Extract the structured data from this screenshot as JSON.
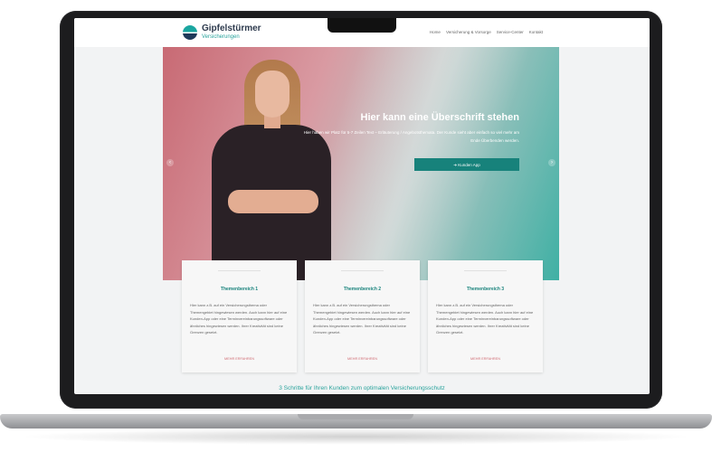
{
  "site": {
    "logo_name": "Gipfelstürmer",
    "logo_sub": "Versicherungen",
    "nav": [
      "Home",
      "Versicherung & Vorsorge",
      "Service-Center",
      "Kontakt"
    ]
  },
  "hero": {
    "title": "Hier kann eine Überschrift stehen",
    "text": "Hier haben wir Platz für 5-7 Zeilen Text – Erläuterung / Angebotsthemata. Der Kunde sieht aber einfach so viel mehr am Ende Überbenden werden.",
    "button_label": "➔ Kunden App",
    "prev_icon": "chevron-left-icon",
    "next_icon": "chevron-right-icon"
  },
  "cards": [
    {
      "title": "Themenbereich 1",
      "text": "Hier kann z.B. auf ein Versicherungsthema oder Themengebiet hingewiesen werden. Auch kann hier auf eine Kunden-App oder eine Terminvereinbarungssoftware oder ähnliches hingewiesen werden. Ihrer Kreativität sind keine Grenzen gesetzt.",
      "link": "MEHR ERFAHREN"
    },
    {
      "title": "Themenbereich 2",
      "text": "Hier kann z.B. auf ein Versicherungsthema oder Themengebiet hingewiesen werden. Auch kann hier auf eine Kunden-App oder eine Terminvereinbarungssoftware oder ähnliches hingewiesen werden. Ihrer Kreativität sind keine Grenzen gesetzt.",
      "link": "MEHR ERFAHREN"
    },
    {
      "title": "Themenbereich 3",
      "text": "Hier kann z.B. auf ein Versicherungsthema oder Themengebiet hingewiesen werden. Auch kann hier auf eine Kunden-App oder eine Terminvereinbarungssoftware oder ähnliches hingewiesen werden. Ihrer Kreativität sind keine Grenzen gesetzt.",
      "link": "MEHR ERFAHREN"
    }
  ],
  "slogan": "3 Schritte für Ihren Kunden zum optimalen Versicherungsschutz",
  "colors": {
    "accent": "#17827b",
    "teal": "#2aa39c",
    "link": "#d06b73"
  }
}
